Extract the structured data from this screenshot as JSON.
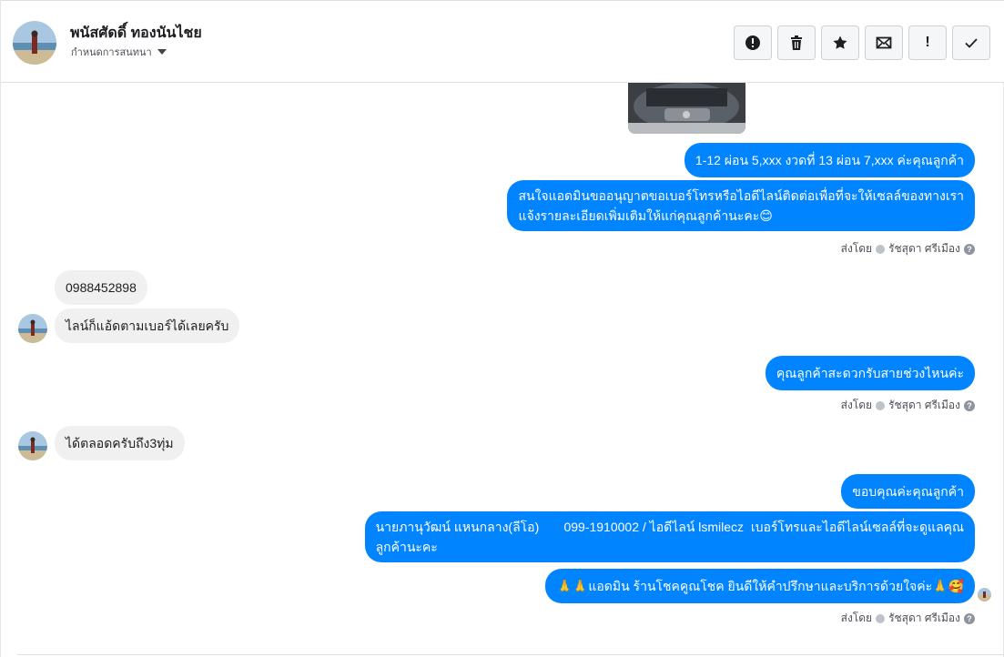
{
  "header": {
    "contact_name": "พนัสศัดดิ์ ทองนันไชย",
    "conversation_settings_label": "กำหนดการสนทนา"
  },
  "toolbar": {
    "buttons": [
      "report-icon",
      "trash-icon",
      "star-icon",
      "envelope-icon",
      "exclamation-icon",
      "check-icon"
    ],
    "exclamation_text": "!"
  },
  "messages": {
    "m1": "1-12 ผ่อน 5,xxx งวดที่ 13  ผ่อน 7,xxx ค่ะคุณลูกค้า",
    "m2_line1": "สนใจแอดมินขออนุญาตขอเบอร์โทรหรือไอดีไลน์ติดต่อเพื่อที่จะให้เซลล์ของทางเรา",
    "m2_line2": "แจ้งรายละเอียดเพิ่มเติมให้แก่คุณลูกค้านะคะ😊",
    "in1": "0988452898",
    "in2": "ไลน์ก็แอ้ดตามเบอร์ได้เลยครับ",
    "m3": "คุณลูกค้าสะดวกรับสายช่วงไหนค่ะ",
    "in3": "ได้ตลอดครับถึง3ทุ่ม",
    "m4": "ขอบคุณค่ะคุณลูกค้า",
    "m5_line1": "นายภานุวัฒน์ แหนกลาง(ลีโอ)       099-1910002 / ไอดีไลน์ lsmilecz  เบอร์โทรและไอดีไลน์เซลล์ที่จะดูแลคุณ",
    "m5_line2": "ลูกค้านะคะ",
    "m6": "🙏🙏แอดมิน ร้านโชคคูณโชค ยินดีให้คำปรึกษาและบริการด้วยใจค่ะ🙏🥰"
  },
  "sent_by": {
    "prefix": "ส่งโดย",
    "agent": "รัชสุดา ศรีเมือง",
    "q": "?"
  },
  "colors": {
    "outgoing_bubble": "#0084ff",
    "incoming_bubble": "#f1f0f0"
  }
}
